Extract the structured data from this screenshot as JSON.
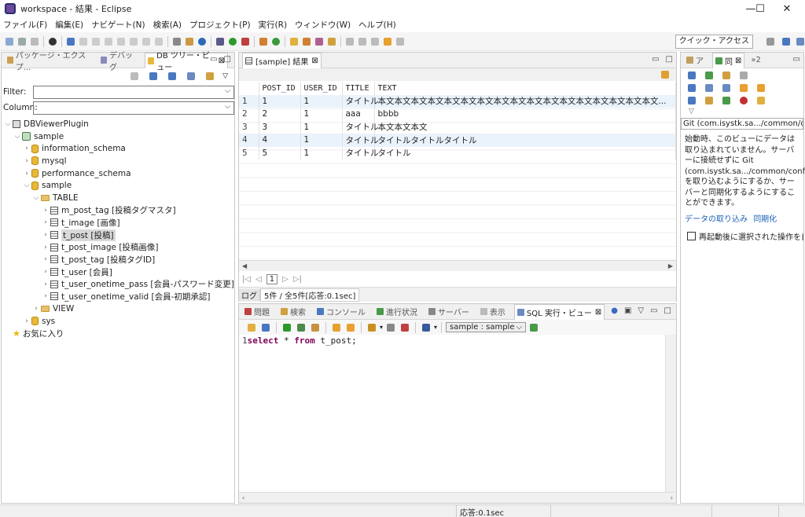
{
  "window": {
    "title": "workspace - 結果 - Eclipse",
    "min": "—",
    "max": "☐",
    "close": "✕"
  },
  "menu": [
    "ファイル(F)",
    "編集(E)",
    "ナビゲート(N)",
    "検索(A)",
    "プロジェクト(P)",
    "実行(R)",
    "ウィンドウ(W)",
    "ヘルプ(H)"
  ],
  "toolbar": {
    "quick_access": "クイック・アクセス"
  },
  "left_panel": {
    "tabs": [
      "パッケージ・エクスプ...",
      "デバッグ",
      "DB ツリー・ビュー"
    ],
    "filter_label": "Filter:",
    "column_label": "Column:",
    "tree": {
      "root": "DBViewerPlugin",
      "connection": "sample",
      "schemas": [
        "information_schema",
        "mysql",
        "performance_schema"
      ],
      "open_schema": "sample",
      "table_folder": "TABLE",
      "tables": [
        "m_post_tag [投稿タグマスタ]",
        "t_image [画像]",
        "t_post [投稿]",
        "t_post_image [投稿画像]",
        "t_post_tag [投稿タグID]",
        "t_user [会員]",
        "t_user_onetime_pass [会員-パスワード変更]",
        "t_user_onetime_valid [会員-初期承認]"
      ],
      "view_folder": "VIEW",
      "sys_schema": "sys",
      "favorites": "お気に入り"
    }
  },
  "result_panel": {
    "tab": "[sample] 結果",
    "columns": [
      "POST_ID",
      "USER_ID",
      "TITLE",
      "TEXT"
    ],
    "rows": [
      {
        "n": "1",
        "post_id": "1",
        "user_id": "1",
        "title": "タイトル",
        "text": "本文本文本文本文本文本文本文本文本文本文本文本文本文本文本文本文本文..."
      },
      {
        "n": "2",
        "post_id": "2",
        "user_id": "1",
        "title": "aaa",
        "text": "bbbb"
      },
      {
        "n": "3",
        "post_id": "3",
        "user_id": "1",
        "title": "タイトル",
        "text": "本文本文本文"
      },
      {
        "n": "4",
        "post_id": "4",
        "user_id": "1",
        "title": "タイトル",
        "text": "タイトルタイトルタイトル"
      },
      {
        "n": "5",
        "post_id": "5",
        "user_id": "1",
        "title": "タイトル",
        "text": "タイトル"
      }
    ],
    "page": "1",
    "log_label": "ログ",
    "summary": "5件 / 全5件[応答:0.1sec]"
  },
  "bottom_panel": {
    "tabs": [
      "問題",
      "検索",
      "コンソール",
      "進行状況",
      "サーバー",
      "表示",
      "SQL 実行・ビュー"
    ],
    "connection_select": "sample : sample",
    "line_no": "1",
    "sql_kw1": "select",
    "sql_mid": " * ",
    "sql_kw2": "from",
    "sql_rest": " t_post;"
  },
  "right_panel": {
    "tabs": [
      "ア",
      "同"
    ],
    "overflow": "»2",
    "header": "Git (com.isystk.sa.../common/confi",
    "description": "始動時、このビューにデータは取り込まれていません。サーバーに接続せずに Git (com.isystk.sa.../common/config) を取り込むようにするか、サーバーと同期化するようにすることができます。",
    "link_import": "データの取り込み",
    "link_sync": "同期化",
    "checkbox_label": "再起動後に選択された操作を自"
  },
  "status": {
    "response": "応答:0.1sec"
  }
}
